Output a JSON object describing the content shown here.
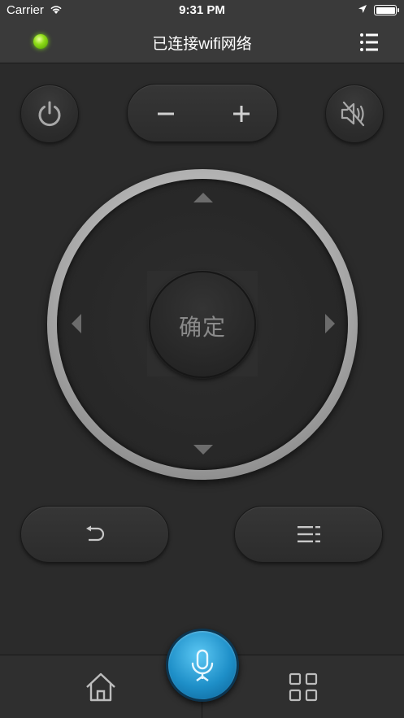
{
  "status_bar": {
    "carrier": "Carrier",
    "time": "9:31 PM"
  },
  "nav": {
    "title": "已连接wifi网络",
    "connection_led_color": "#7bd41a",
    "menu_icon": "list-icon"
  },
  "controls": {
    "power_icon": "power-icon",
    "mute_icon": "mute-icon",
    "volume_down_icon": "minus-icon",
    "volume_up_icon": "plus-icon",
    "ok_label": "确定",
    "back_icon": "back-icon",
    "menu_icon": "menu-lines-icon"
  },
  "bottom_bar": {
    "home_icon": "home-icon",
    "voice_icon": "microphone-icon",
    "apps_icon": "grid-icon",
    "accent_color": "#1e8fc8"
  }
}
